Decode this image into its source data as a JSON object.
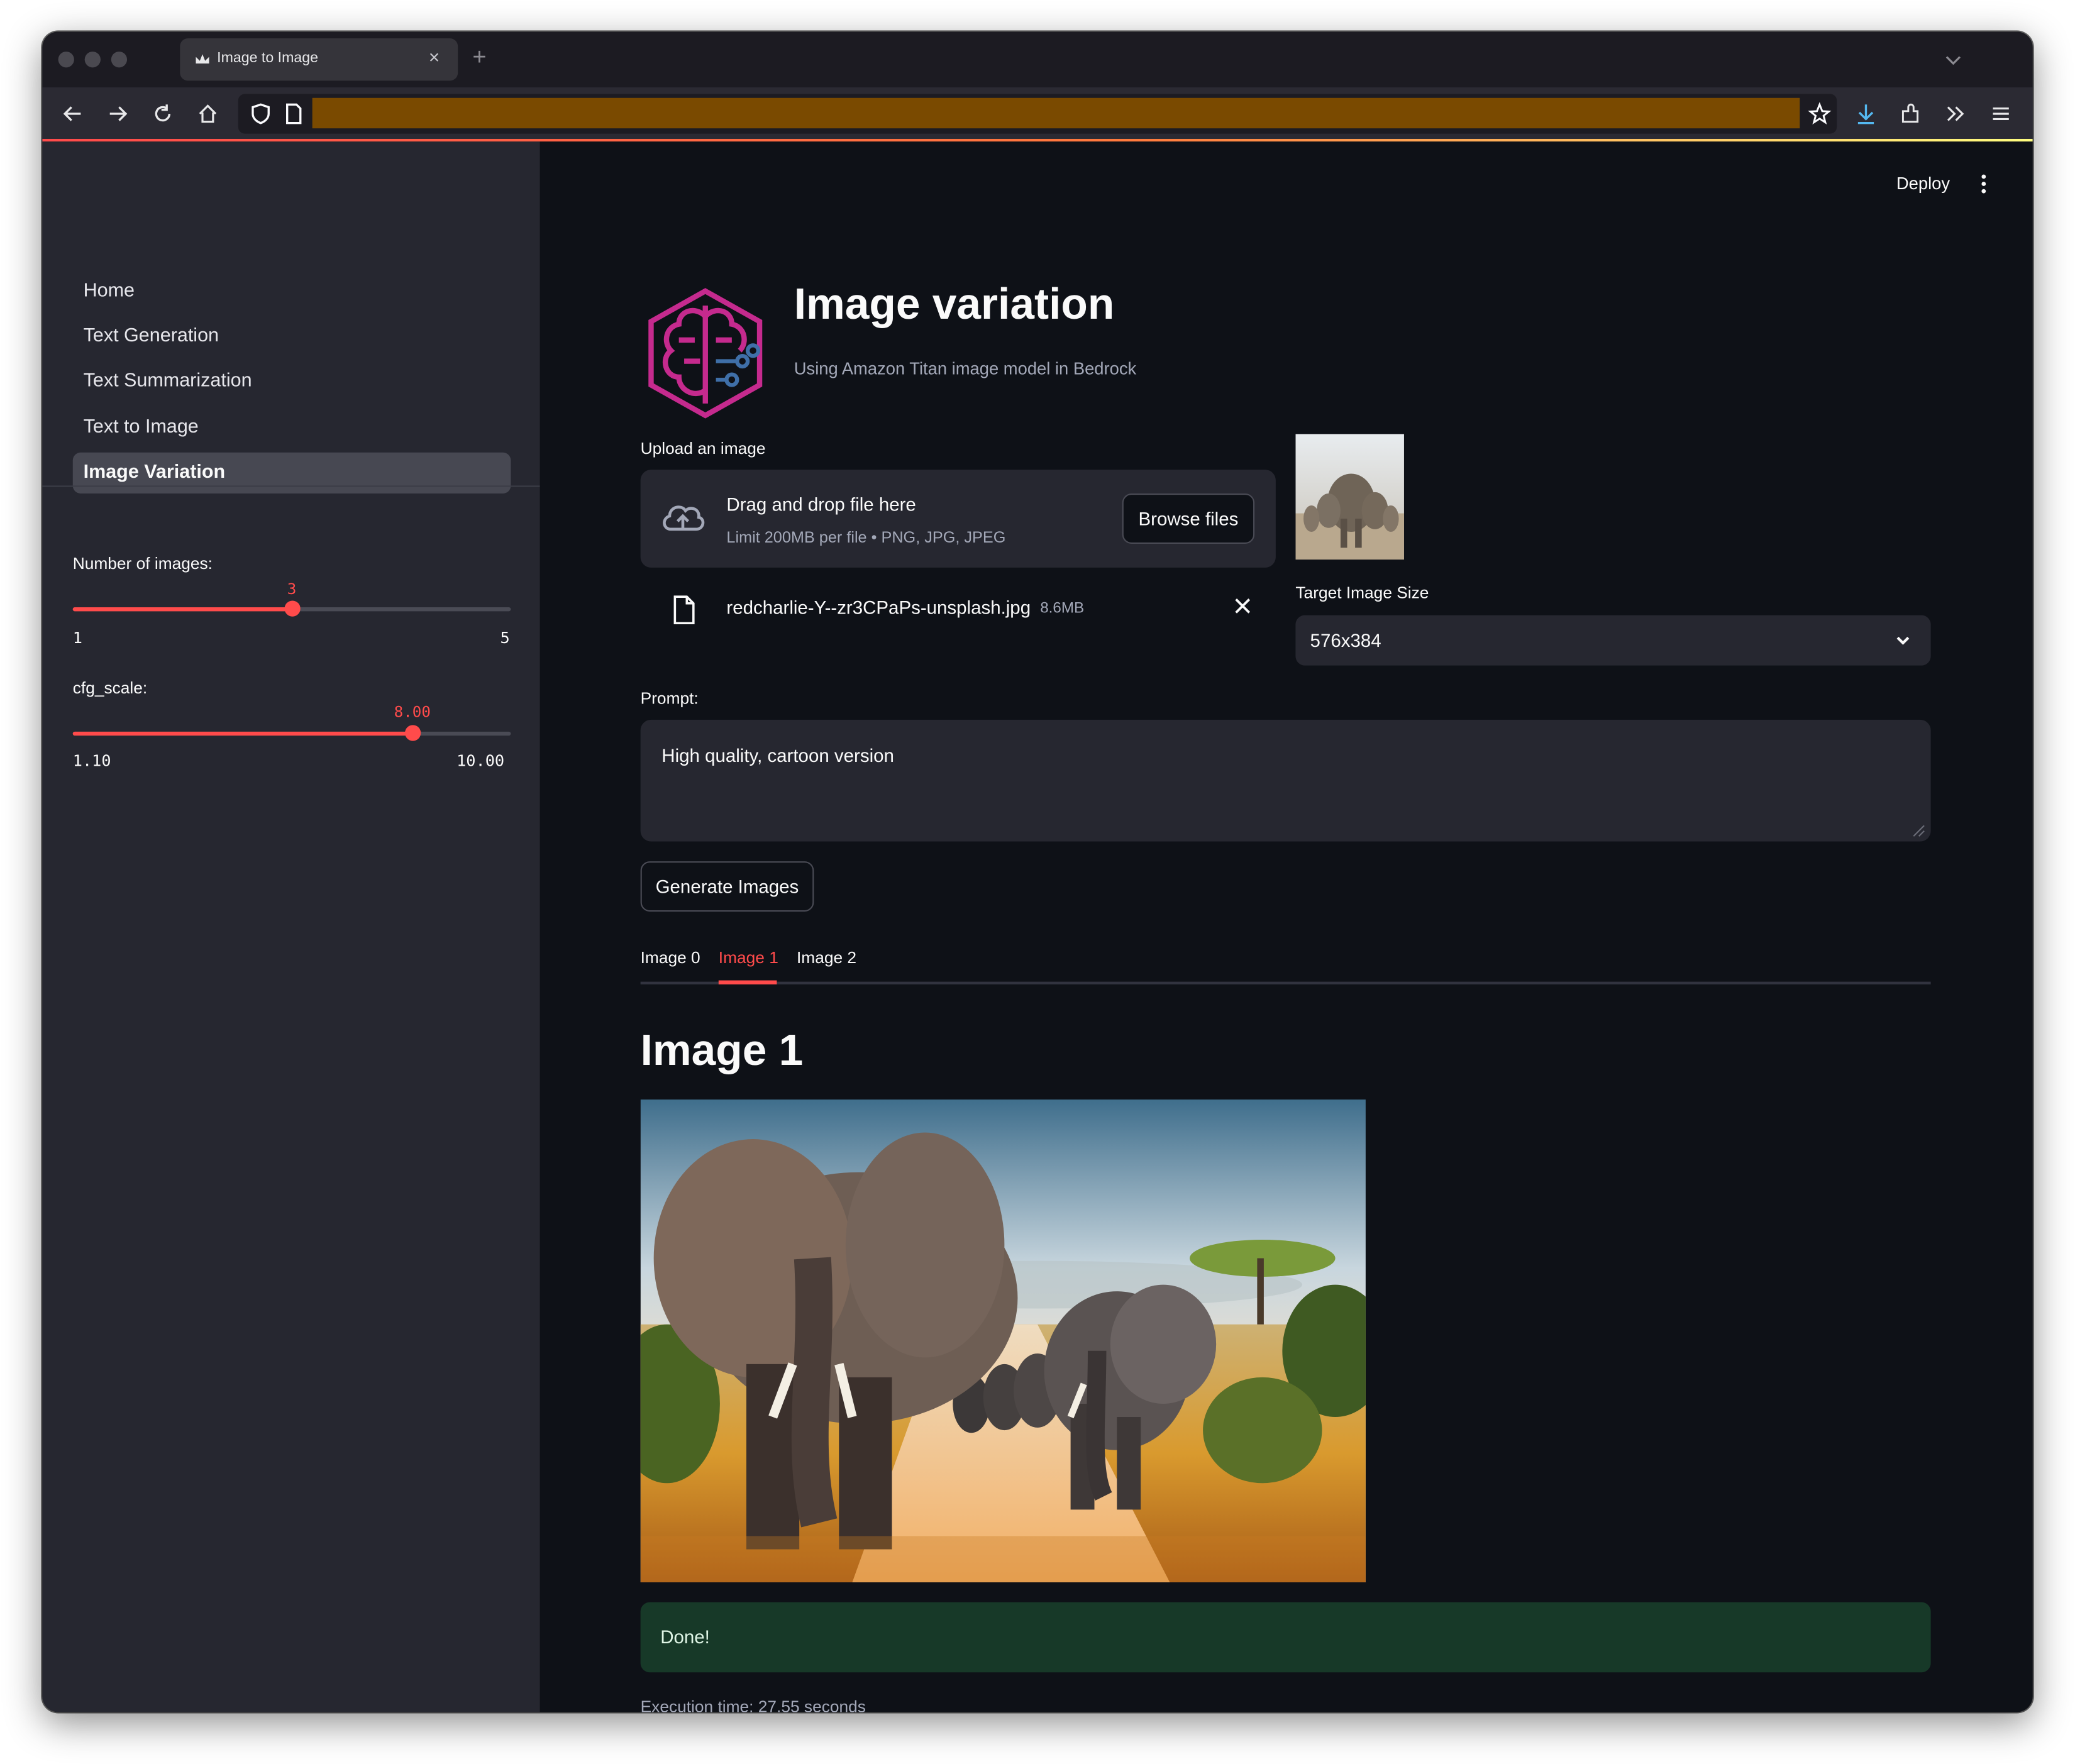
{
  "browser": {
    "tab_title": "Image to Image",
    "new_tab_symbol": "+",
    "close_symbol": "×"
  },
  "sidebar": {
    "nav": [
      {
        "label": "Home"
      },
      {
        "label": "Text Generation"
      },
      {
        "label": "Text Summarization"
      },
      {
        "label": "Text to Image"
      },
      {
        "label": "Image Variation",
        "active": true
      }
    ],
    "num_images": {
      "label": "Number of images:",
      "value": 3,
      "min": 1,
      "max": 5,
      "value_text": "3",
      "min_text": "1",
      "max_text": "5"
    },
    "cfg_scale": {
      "label": "cfg_scale:",
      "value": 8.0,
      "min": 1.1,
      "max": 10.0,
      "value_text": "8.00",
      "min_text": "1.10",
      "max_text": "10.00"
    }
  },
  "header": {
    "deploy": "Deploy"
  },
  "page": {
    "title": "Image variation",
    "subtitle": "Using Amazon Titan image model in Bedrock"
  },
  "upload": {
    "label": "Upload an image",
    "drag_text": "Drag and drop file here",
    "limit_text": "Limit 200MB per file • PNG, JPG, JPEG",
    "browse_label": "Browse files",
    "file_name": "redcharlie-Y--zr3CPaPs-unsplash.jpg",
    "file_size": "8.6MB"
  },
  "target_size": {
    "label": "Target Image Size",
    "value": "576x384"
  },
  "prompt": {
    "label": "Prompt:",
    "value": "High quality, cartoon version"
  },
  "generate_label": "Generate Images",
  "result_tabs": [
    {
      "label": "Image 0"
    },
    {
      "label": "Image 1",
      "active": true
    },
    {
      "label": "Image 2"
    }
  ],
  "result": {
    "heading": "Image 1",
    "status": "Done!",
    "execution_time": "Execution time: 27.55 seconds"
  },
  "colors": {
    "accent": "#ff4b4b",
    "success_bg": "#173928",
    "main_bg": "#0e1117",
    "sidebar_bg": "#262730",
    "url_highlight": "#7a4a00"
  },
  "icons": [
    "back-icon",
    "forward-icon",
    "reload-icon",
    "home-icon",
    "shield-icon",
    "page-icon",
    "star-icon",
    "download-icon",
    "extensions-icon",
    "overflow-icon",
    "menu-icon",
    "upload-cloud-icon",
    "file-icon",
    "close-icon",
    "chevron-down-icon",
    "kebab-icon"
  ]
}
